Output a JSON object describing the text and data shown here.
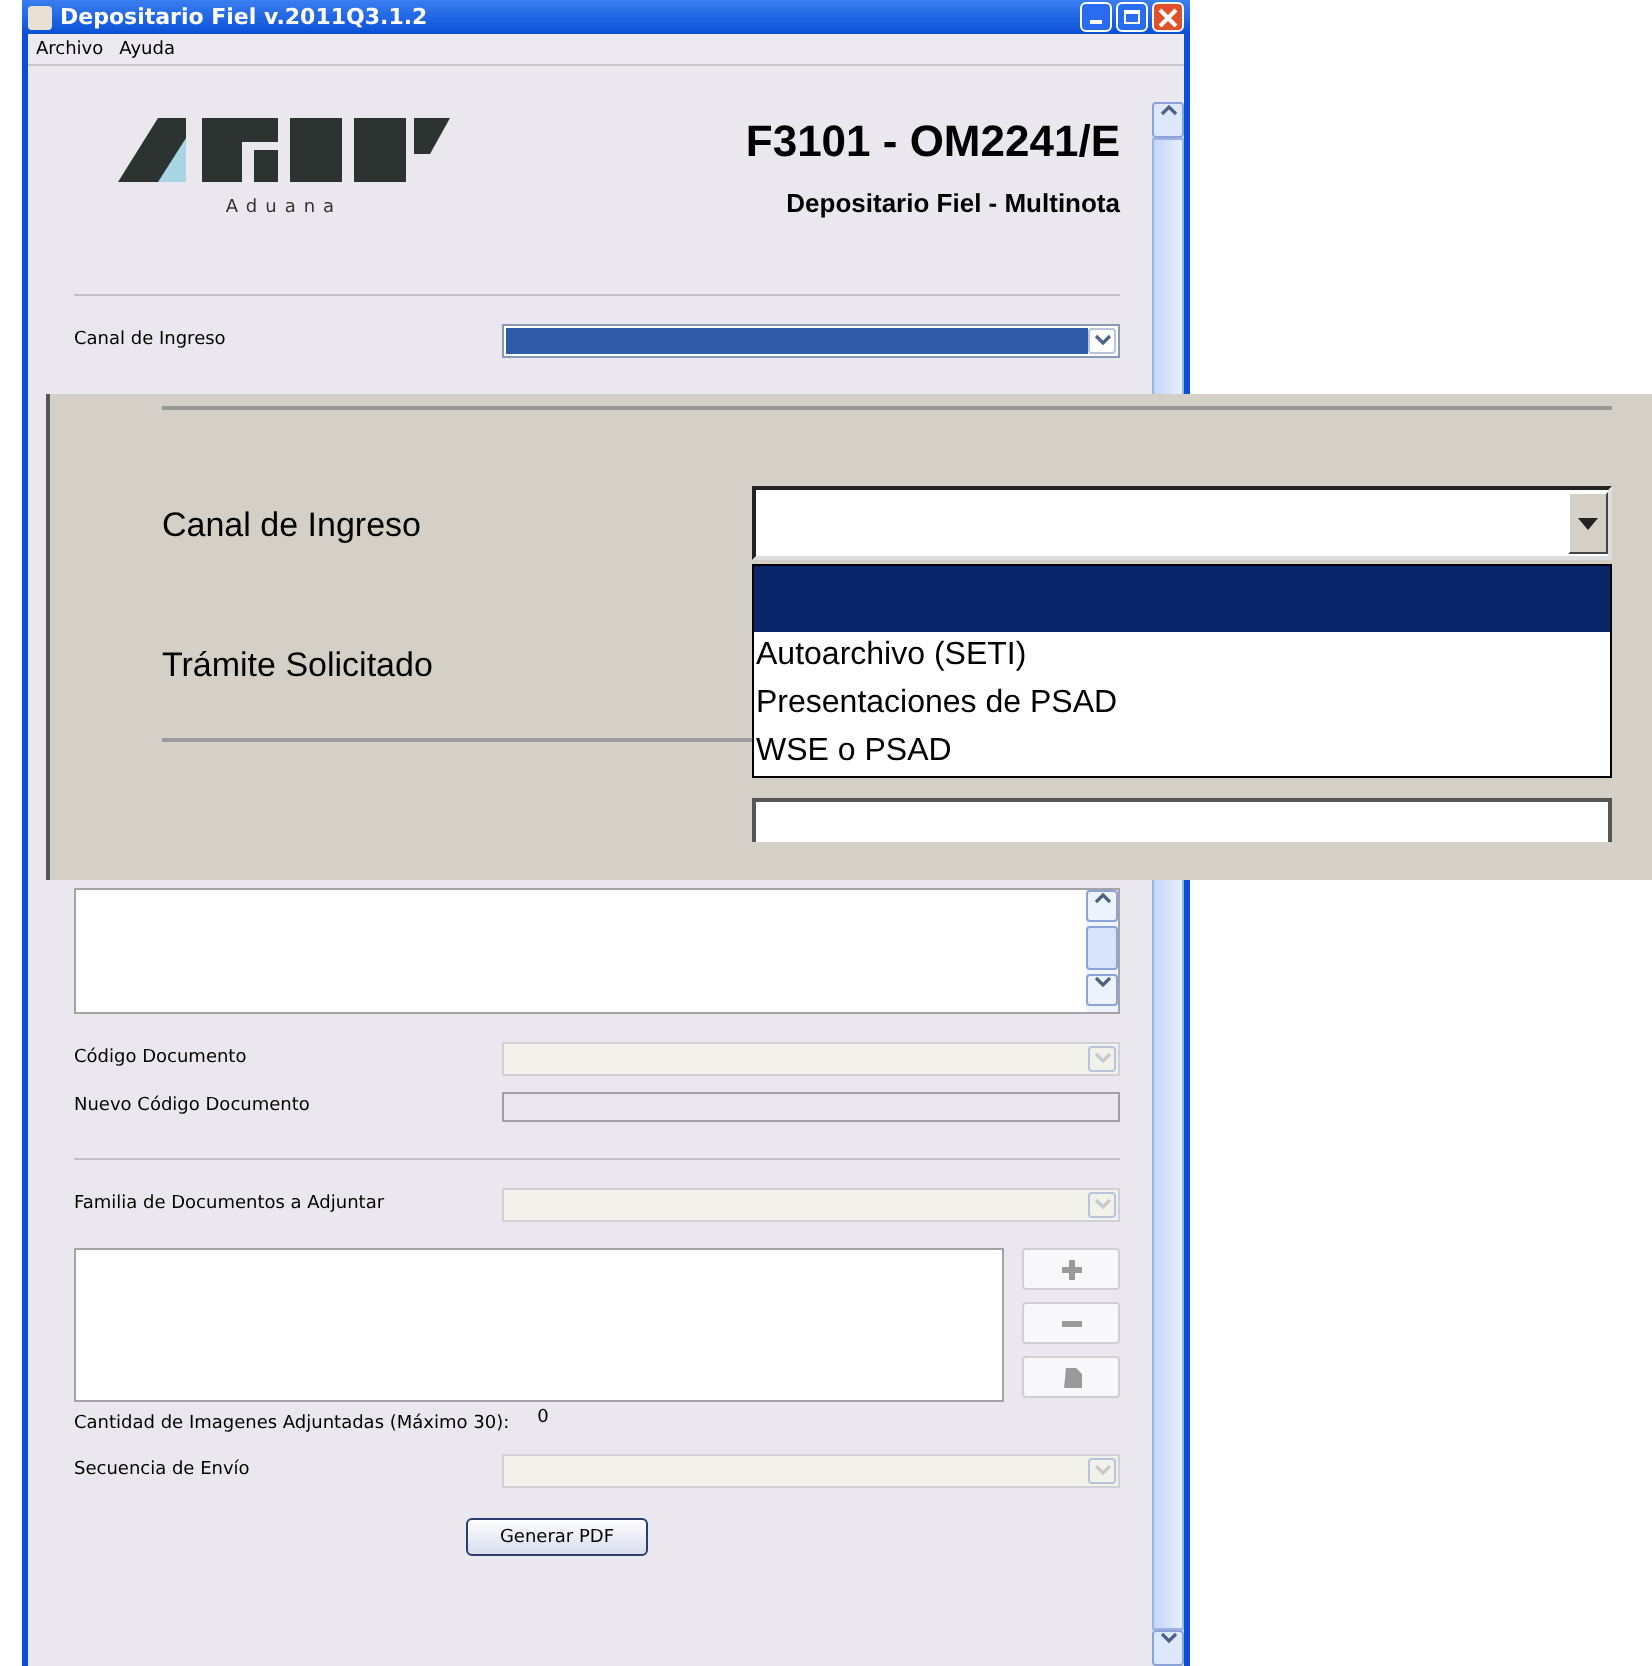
{
  "window": {
    "title": "Depositario Fiel v.2011Q3.1.2"
  },
  "menu": [
    "Archivo",
    "Ayuda"
  ],
  "header": {
    "logo_caption": "Aduana",
    "title": "F3101 - OM2241/E",
    "subtitle": "Depositario Fiel - Multinota"
  },
  "channel_field": {
    "label": "Canal de Ingreso",
    "highlighted": true
  },
  "zoom_inset": {
    "fields": [
      {
        "label": "Canal de Ingreso",
        "kind": "combo",
        "expanded": true
      },
      {
        "label": "Trámite Solicitado",
        "kind": "plain"
      }
    ],
    "dropdown": {
      "blank_selected": true,
      "options": [
        {
          "label": "Autoarchivo (SETI)",
          "selected": false
        },
        {
          "label": "Presentaciones de PSAD",
          "selected": false
        },
        {
          "label": "WSE o PSAD",
          "selected": false
        }
      ]
    }
  },
  "document_fields": [
    {
      "label": "Código Documento",
      "kind": "combo",
      "disabled": true
    },
    {
      "label": "Nuevo Código Documento",
      "kind": "text",
      "disabled": true
    }
  ],
  "family_field": {
    "label": "Familia de Documentos a Adjuntar",
    "kind": "combo",
    "disabled": true
  },
  "image_count": {
    "label": "Cantidad de Imagenes Adjuntadas (Máximo 30):",
    "value": "0"
  },
  "sequence_field": {
    "label": "Secuencia de Envío",
    "kind": "combo",
    "disabled": true
  },
  "buttons": [
    "Generar PDF"
  ]
}
